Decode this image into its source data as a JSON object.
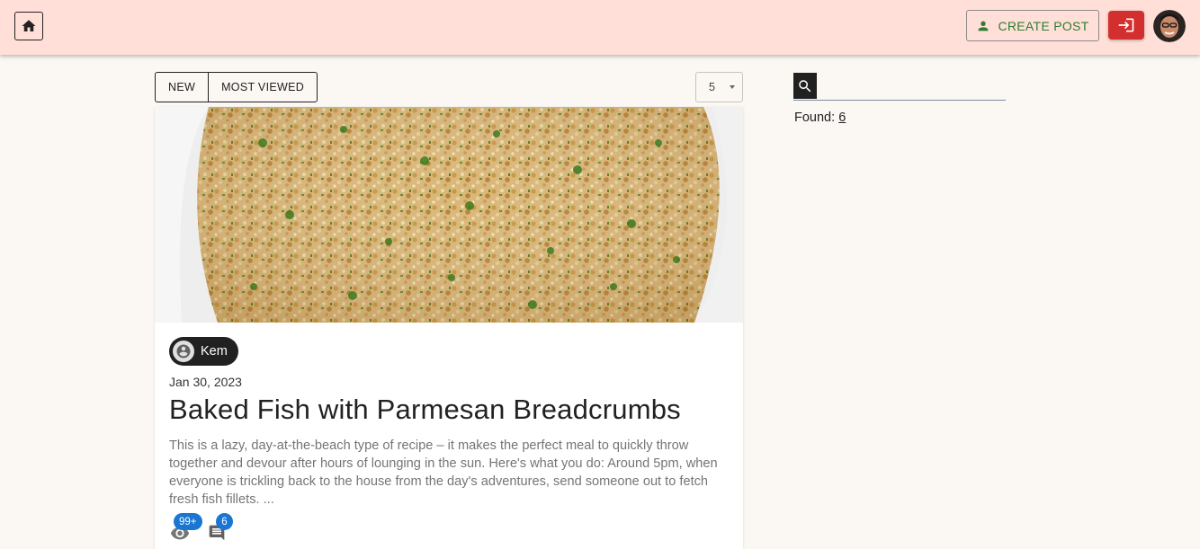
{
  "header": {
    "create_post_label": "CREATE POST",
    "brand_color": "#ffdfd7",
    "accent_color": "#d32f2f",
    "create_color": "#2e7d32"
  },
  "icons": {
    "home": "home-icon",
    "create_post": "person-icon",
    "login": "login-icon",
    "search": "search-icon",
    "views": "eye-icon",
    "comments": "comment-icon"
  },
  "toolbar": {
    "sort_options": [
      "NEW",
      "MOST VIEWED"
    ],
    "page_size_value": "5"
  },
  "posts": [
    {
      "author": "Kem",
      "date": "Jan 30, 2023",
      "title": "Baked Fish with Parmesan Breadcrumbs",
      "excerpt": "This is a lazy, day-at-the-beach type of recipe – it makes the perfect meal to quickly throw together and devour after hours of lounging in the sun. Here's what you do: Around 5pm, when everyone is trickling back to the house from the day's adventures, send someone out to fetch fresh fish fillets. ...",
      "views_badge": "99+",
      "comments_badge": "6"
    }
  ],
  "search": {
    "placeholder": "",
    "found_label": "Found:",
    "found_count": "6"
  }
}
